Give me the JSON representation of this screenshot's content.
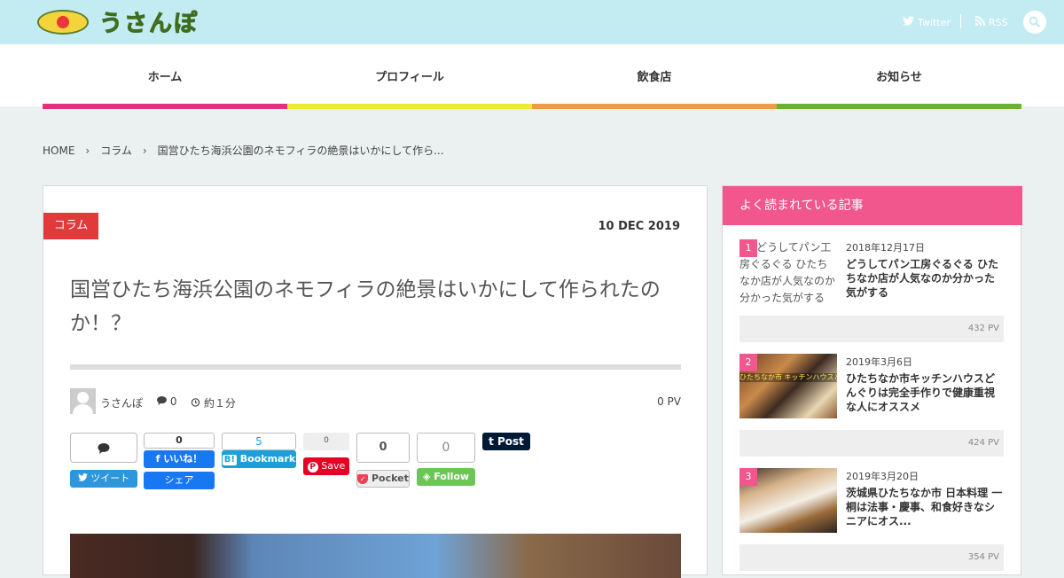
{
  "header": {
    "logo_text": "うさんぽ",
    "twitter_label": "Twitter",
    "rss_label": "RSS"
  },
  "nav": {
    "items": [
      {
        "label": "ホーム",
        "color": "#e3317d"
      },
      {
        "label": "プロフィール",
        "color": "#ecea36"
      },
      {
        "label": "飲食店",
        "color": "#ec9c47"
      },
      {
        "label": "お知らせ",
        "color": "#6ab233"
      }
    ]
  },
  "breadcrumb": {
    "home": "HOME",
    "category": "コラム",
    "current": "国営ひたち海浜公園のネモフィラの絶景はいかにして作ら..."
  },
  "article": {
    "category": "コラム",
    "date": "10 DEC 2019",
    "title": "国営ひたち海浜公園のネモフィラの絶景はいかにして作られたのか！？",
    "author": "うさんぽ",
    "comment_count": "0",
    "read_time": "約１分",
    "pv": "0 PV"
  },
  "share": {
    "comment_count": "",
    "tweet_label": "ツイート",
    "fb_count": "0",
    "fb_like_label": "いいね！",
    "fb_share_label": "シェア",
    "hatena_count": "5",
    "hatena_label": "Bookmark",
    "pinterest_count": "0",
    "pinterest_label": "Save",
    "pocket_count": "0",
    "pocket_label": "Pocket",
    "feedly_count": "0",
    "feedly_label": "Follow",
    "tumblr_label": "Post"
  },
  "sidebar": {
    "heading": "よく読まれている記事",
    "ranking": [
      {
        "rank": "1",
        "date": "2018年12月17日",
        "title": "どうしてパン工房ぐるぐる ひたちなか店が人気なのか分かった気がする",
        "thumb_alt": "どうしてパン工房ぐるぐる ひたちなか店が人気なのか分かった気がする",
        "pv": "432 PV"
      },
      {
        "rank": "2",
        "date": "2019年3月6日",
        "title": "ひたちなか市キッチンハウスどんぐりは完全手作りで健康重視な人にオススメ",
        "thumb_caption": "ひたちなか市 キッチンハウスどんぐりに行ってみ",
        "pv": "424 PV"
      },
      {
        "rank": "3",
        "date": "2019年3月20日",
        "title": "茨城県ひたちなか市 日本料理 一桐は法事・慶事、和食好きなシニアにオス...",
        "pv": "354 PV"
      }
    ]
  }
}
